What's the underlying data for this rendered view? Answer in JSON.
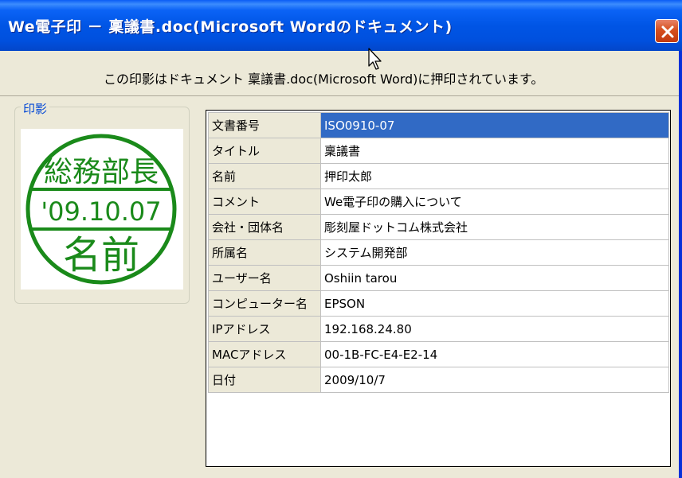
{
  "window": {
    "title": "We電子印 － 稟議書.doc(Microsoft Wordのドキュメント)",
    "info_text": "この印影はドキュメント 稟議書.doc(Microsoft Word)に押印されています。"
  },
  "stamp_group": {
    "label": "印影",
    "stamp": {
      "top": "総務部長",
      "date": "'09.10.07",
      "bottom": "名前",
      "color": "#1a8a1a"
    }
  },
  "properties": {
    "rows": [
      {
        "key": "文書番号",
        "value": "ISO0910-07",
        "selected": true
      },
      {
        "key": "タイトル",
        "value": "稟議書"
      },
      {
        "key": "名前",
        "value": "押印太郎"
      },
      {
        "key": "コメント",
        "value": "We電子印の購入について"
      },
      {
        "key": "会社・団体名",
        "value": "彫刻屋ドットコム株式会社"
      },
      {
        "key": "所属名",
        "value": "システム開発部"
      },
      {
        "key": "ユーザー名",
        "value": "Oshiin tarou"
      },
      {
        "key": "コンピューター名",
        "value": "EPSON"
      },
      {
        "key": "IPアドレス",
        "value": "192.168.24.80"
      },
      {
        "key": "MACアドレス",
        "value": "00-1B-FC-E4-E2-14"
      },
      {
        "key": "日付",
        "value": "2009/10/7"
      }
    ]
  },
  "colors": {
    "titlebar": "#0055e5",
    "selection": "#316ac5",
    "stamp": "#1a8a1a",
    "group_label": "#0046d5"
  }
}
